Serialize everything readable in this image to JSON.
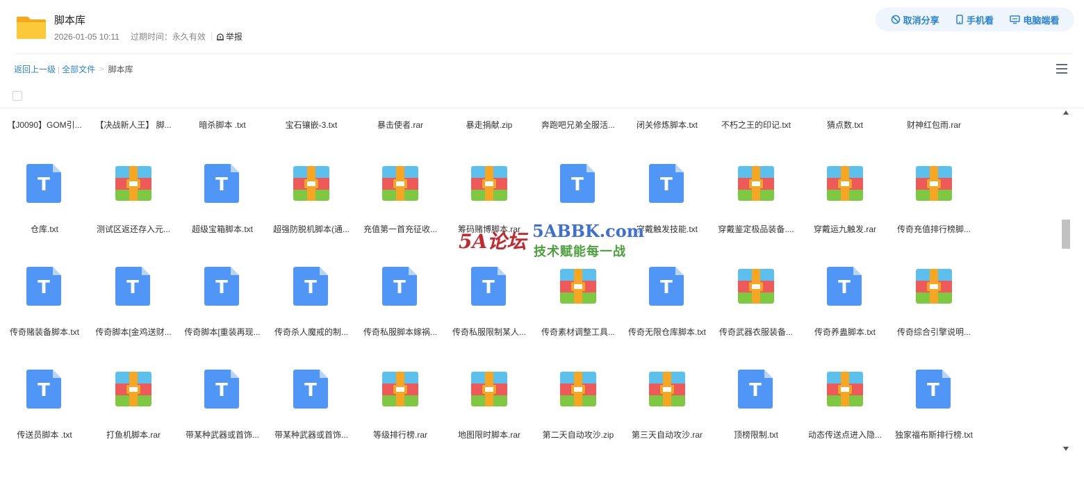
{
  "share": {
    "title": "脚本库",
    "date": "2026-01-05 10:11",
    "expire_label": "过期时间：",
    "expire_value": "永久有效",
    "report_label": "举报"
  },
  "actions": {
    "cancel_share": "取消分享",
    "mobile_view": "手机看",
    "pc_view": "电脑端看"
  },
  "breadcrumb": {
    "back": "返回上一级",
    "all_files": "全部文件",
    "current": "脚本库"
  },
  "top_row": [
    "【J0090】GOM引...",
    "【决战新人王】 脚...",
    "暗杀脚本 .txt",
    "宝石镶嵌-3.txt",
    "暴击使者.rar",
    "暴走捐献.zip",
    "奔跑吧兄弟全服活...",
    "闭关修炼脚本.txt",
    "不朽之王的印记.txt",
    "猜点数.txt",
    "财神红包雨.rar"
  ],
  "rows": [
    [
      {
        "name": "仓库.txt",
        "icon": "txt-icon"
      },
      {
        "name": "测试区返还存入元...",
        "icon": "rar-icon"
      },
      {
        "name": "超级宝箱脚本.txt",
        "icon": "txt-icon"
      },
      {
        "name": "超强防脱机脚本(通...",
        "icon": "rar-icon"
      },
      {
        "name": "充值第一首充征收...",
        "icon": "rar-icon"
      },
      {
        "name": "筹码赌博脚本.rar",
        "icon": "rar-icon"
      },
      {
        "name": "",
        "icon": "txt-icon"
      },
      {
        "name": "穿戴触发技能.txt",
        "icon": "txt-icon"
      },
      {
        "name": "穿戴鉴定极品装备....",
        "icon": "rar-icon"
      },
      {
        "name": "穿戴运九触发.rar",
        "icon": "rar-icon"
      },
      {
        "name": "传奇充值排行榜脚...",
        "icon": "rar-icon"
      }
    ],
    [
      {
        "name": "传奇赌装备脚本.txt",
        "icon": "txt-icon"
      },
      {
        "name": "传奇脚本[金鸡送财...",
        "icon": "txt-icon"
      },
      {
        "name": "传奇脚本[重装再现...",
        "icon": "txt-icon"
      },
      {
        "name": "传奇杀人魔戒的制...",
        "icon": "txt-icon"
      },
      {
        "name": "传奇私服脚本嫁祸...",
        "icon": "txt-icon"
      },
      {
        "name": "传奇私服限制某人...",
        "icon": "txt-icon"
      },
      {
        "name": "传奇素材调整工具...",
        "icon": "rar-icon"
      },
      {
        "name": "传奇无限仓库脚本.txt",
        "icon": "txt-icon"
      },
      {
        "name": "传奇武器衣服装备...",
        "icon": "rar-icon"
      },
      {
        "name": "传奇养蛊脚本.txt",
        "icon": "txt-icon"
      },
      {
        "name": "传奇综合引擎说明...",
        "icon": "rar-icon"
      }
    ],
    [
      {
        "name": "传送员脚本 .txt",
        "icon": "txt-icon"
      },
      {
        "name": "打鱼机脚本.rar",
        "icon": "rar-icon"
      },
      {
        "name": "带某种武器或首饰...",
        "icon": "txt-icon"
      },
      {
        "name": "带某种武器或首饰...",
        "icon": "txt-icon"
      },
      {
        "name": "等级排行榜.rar",
        "icon": "rar-icon"
      },
      {
        "name": "地图限时脚本.rar",
        "icon": "rar-icon"
      },
      {
        "name": "第二天自动攻沙.zip",
        "icon": "rar-icon"
      },
      {
        "name": "第三天自动攻沙.rar",
        "icon": "rar-icon"
      },
      {
        "name": "顶榜限制.txt",
        "icon": "txt-icon"
      },
      {
        "name": "动态传送点进入隐...",
        "icon": "rar-icon"
      },
      {
        "name": "独家福布斯排行榜.txt",
        "icon": "txt-icon"
      }
    ]
  ],
  "txt_letter": "T",
  "watermark": {
    "logo": "5A论坛",
    "site": "5ABBK.com",
    "slogan": "技术赋能每一战"
  },
  "colors": {
    "accent": "#2b83d6",
    "txt_icon": "#4f96f6",
    "folder": "#f7b524"
  }
}
